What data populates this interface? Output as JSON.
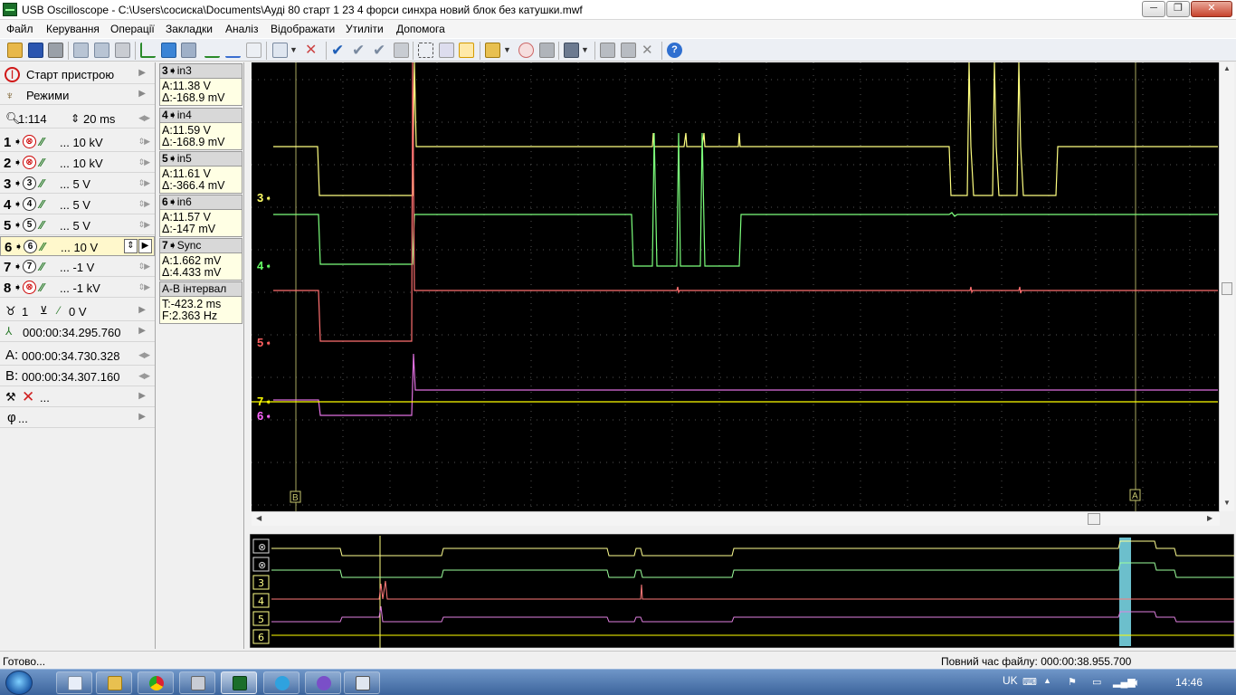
{
  "window": {
    "title": "USB Oscilloscope - C:\\Users\\сосиска\\Documents\\Ауді 80 старт  1 23 4 форси синхра новий  блок без катушки.mwf",
    "min_label": "─",
    "max_label": "❐",
    "close_label": "✕"
  },
  "menu": [
    "Файл",
    "Керування",
    "Операції",
    "Закладки",
    "Аналіз",
    "Відображати",
    "Утиліти",
    "Допомога"
  ],
  "left": {
    "start": "Старт пристрою",
    "modes": "Режими",
    "zoom": "1:114",
    "timebase": "20 ms",
    "channels": [
      {
        "num": "1",
        "sym": "⊗",
        "off": true,
        "scale": "... 10 kV"
      },
      {
        "num": "2",
        "sym": "⊗",
        "off": true,
        "scale": "... 10 kV"
      },
      {
        "num": "3",
        "sym": "3",
        "off": false,
        "scale": "... 5 V"
      },
      {
        "num": "4",
        "sym": "4",
        "off": false,
        "scale": "... 5 V"
      },
      {
        "num": "5",
        "sym": "5",
        "off": false,
        "scale": "... 5 V"
      },
      {
        "num": "6",
        "sym": "6",
        "off": false,
        "scale": "... 10 V"
      },
      {
        "num": "7",
        "sym": "7",
        "off": false,
        "scale": "... -1 V"
      },
      {
        "num": "8",
        "sym": "⊗",
        "off": true,
        "scale": "... -1 kV"
      }
    ],
    "trigger_channel": "1",
    "trigger_level": "0 V",
    "trigger_time": "000:00:34.295.760",
    "cursor_a_label": "A:",
    "cursor_a": "000:00:34.730.328",
    "cursor_b_label": "B:",
    "cursor_b": "000:00:34.307.160",
    "filter_text": "...",
    "phi_text": "..."
  },
  "measurements": [
    {
      "head_num": "3",
      "head": "in3",
      "a": "A:11.38 V",
      "d": "Δ:-168.9 mV"
    },
    {
      "head_num": "4",
      "head": "in4",
      "a": "A:11.59 V",
      "d": "Δ:-168.9 mV"
    },
    {
      "head_num": "5",
      "head": "in5",
      "a": "A:11.61 V",
      "d": "Δ:-366.4 mV"
    },
    {
      "head_num": "6",
      "head": "in6",
      "a": "A:11.57 V",
      "d": "Δ:-147 mV"
    },
    {
      "head_num": "7",
      "head": "Sync",
      "a": "A:1.662 mV",
      "d": "Δ:4.433 mV"
    },
    {
      "head_num": "",
      "head": "A-B інтервал",
      "a": "T:-423.2 ms",
      "d": "F:2.363 Hz"
    }
  ],
  "scope": {
    "channel_markers": [
      {
        "label": "3",
        "color": "#ffff66"
      },
      {
        "label": "4",
        "color": "#66ff66"
      },
      {
        "label": "5",
        "color": "#ff6060"
      },
      {
        "label": "7",
        "color": "#ffff00"
      },
      {
        "label": "6",
        "color": "#ff66ff"
      }
    ],
    "cursor_b_tag": "B",
    "cursor_a_tag": "A",
    "colors": {
      "bg": "#000000",
      "grid": "#5a5a5a",
      "ch3": "#ffff80",
      "ch4": "#7cff7c",
      "ch5": "#ff7070",
      "ch6": "#e070e0",
      "ch7": "#ffff00",
      "cursor": "#a8a860"
    }
  },
  "overview": {
    "labels": [
      "⊗",
      "⊗",
      "3",
      "4",
      "5",
      "6"
    ]
  },
  "status": {
    "left": "Готово...",
    "right": "Повний час файлу: 000:00:38.955.700"
  },
  "taskbar": {
    "lang": "UK",
    "clock": "14:46"
  }
}
